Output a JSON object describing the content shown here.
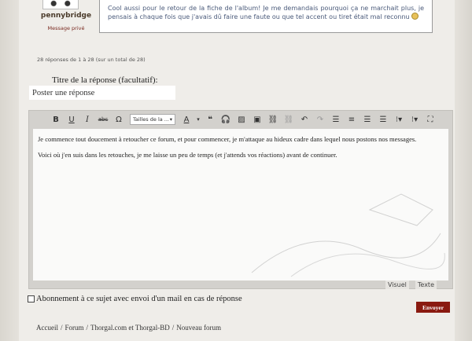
{
  "post": {
    "author": "pennybridge",
    "private_message_label": "Message privé",
    "message": "Cool aussi pour le retour de la fiche de l'album! Je me demandais pourquoi ça ne marchait plus, je pensais à chaque fois que j'avais dû faire une faute ou que tel accent ou tiret était mal reconnu"
  },
  "reply_count": "28 réponses de 1 à 28 (sur un total de 28)",
  "reply_form": {
    "title_label": "Titre de la réponse (facultatif):",
    "title_value": "Poster une réponse",
    "toolbar": {
      "font_size_select": "Tailles de la ..."
    },
    "editor_paragraphs": [
      "Je commence tout doucement à retoucher ce forum, et pour commencer, je m'attaque au hideux cadre dans lequel nous postons nos messages.",
      "Voici où j'en suis dans les retouches, je me laisse un peu de temps (et j'attends vos réactions) avant de continuer."
    ],
    "mode_tabs": [
      "Visuel",
      "Texte"
    ],
    "subscribe_label": "Abonnement à ce sujet avec envoi d'un mail en cas de réponse",
    "send_label": "Envoyer"
  },
  "breadcrumb": [
    "Accueil",
    "Forum",
    "Thorgal.com et Thorgal-BD",
    "Nouveau forum"
  ],
  "breadcrumb_separator": "/",
  "colors": {
    "send_button": "#8a1a10",
    "message_text": "#4a5a7a"
  }
}
